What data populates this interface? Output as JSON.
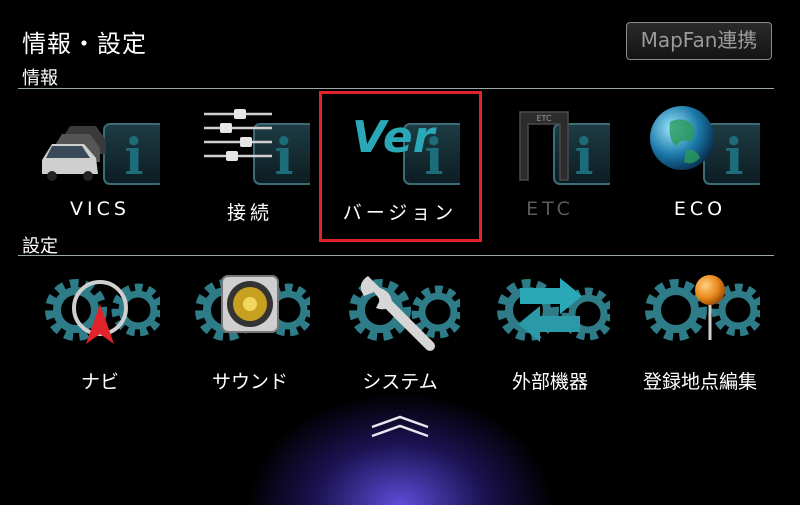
{
  "header": {
    "title": "情報・設定",
    "mapfan_button": "MapFan連携"
  },
  "info_section": {
    "title": "情報",
    "items": [
      {
        "label": "VICS",
        "icon": "vics-icon",
        "enabled": true
      },
      {
        "label": "接続",
        "icon": "connection-icon",
        "enabled": true
      },
      {
        "label": "バージョン",
        "icon": "version-icon",
        "enabled": true,
        "selected": true
      },
      {
        "label": "ETC",
        "icon": "etc-icon",
        "enabled": false
      },
      {
        "label": "ECO",
        "icon": "eco-icon",
        "enabled": true
      }
    ]
  },
  "settings_section": {
    "title": "設定",
    "items": [
      {
        "label": "ナビ",
        "icon": "navi-icon"
      },
      {
        "label": "サウンド",
        "icon": "sound-icon"
      },
      {
        "label": "システム",
        "icon": "system-icon"
      },
      {
        "label": "外部機器",
        "icon": "external-device-icon"
      },
      {
        "label": "登録地点編集",
        "icon": "registered-point-icon"
      }
    ]
  },
  "version_badge": "Ver",
  "etc_badge": "ETC",
  "info_badge": "i",
  "colors": {
    "selection": "#e0232a",
    "teal": "#2aa8b8",
    "disabled": "#5a5a5a"
  }
}
